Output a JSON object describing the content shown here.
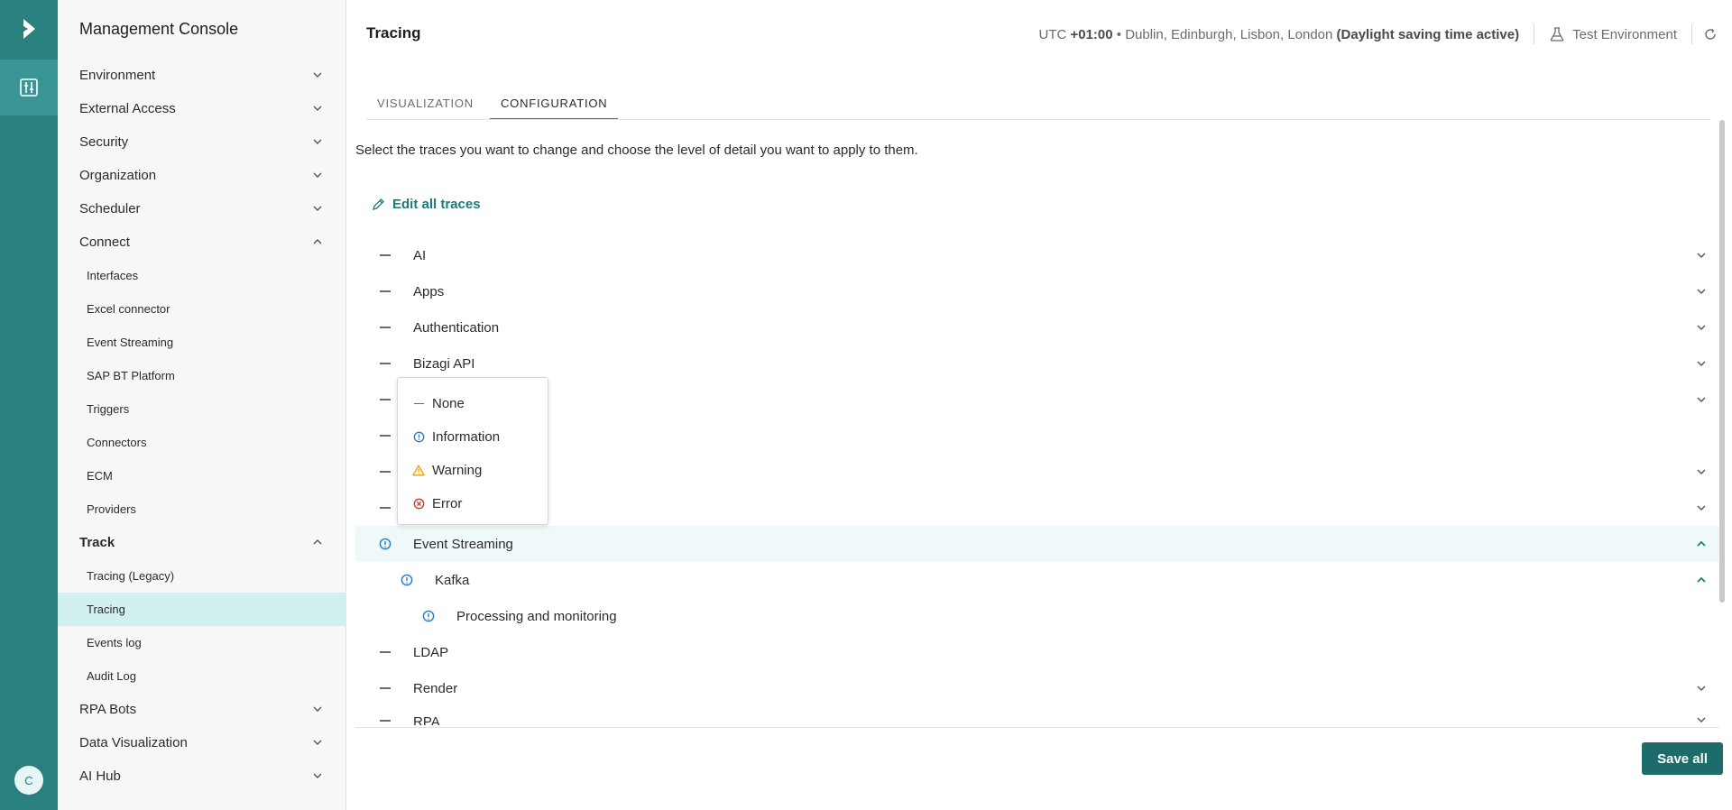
{
  "app": {
    "title": "Management Console",
    "avatar_initial": "C"
  },
  "colors": {
    "accent": "#2a7f7f",
    "info": "#1f7acc",
    "warning": "#e8a000",
    "error": "#d93025"
  },
  "sidebar": {
    "sections": [
      {
        "label": "Environment"
      },
      {
        "label": "External Access"
      },
      {
        "label": "Security"
      },
      {
        "label": "Organization"
      },
      {
        "label": "Scheduler"
      },
      {
        "label": "Connect",
        "children": [
          "Interfaces",
          "Excel connector",
          "Event Streaming",
          "SAP BT Platform",
          "Triggers",
          "Connectors",
          "ECM",
          "Providers"
        ]
      },
      {
        "label": "Track",
        "children": [
          "Tracing (Legacy)",
          "Tracing",
          "Events log",
          "Audit Log"
        ]
      },
      {
        "label": "RPA Bots"
      },
      {
        "label": "Data Visualization"
      },
      {
        "label": "AI Hub"
      }
    ]
  },
  "header": {
    "title": "Tracing",
    "tz_prefix": "UTC ",
    "tz_offset": "+01:00",
    "tz_cities": " • Dublin, Edinburgh, Lisbon, London ",
    "tz_dst": "(Daylight saving time active)",
    "environment": "Test Environment"
  },
  "tabs": [
    {
      "label": "VISUALIZATION"
    },
    {
      "label": "CONFIGURATION"
    }
  ],
  "config": {
    "description": "Select the traces you want to change and choose the level of detail you want to apply to them.",
    "edit_all": "Edit all traces",
    "traces": [
      {
        "name": "AI",
        "level": "none"
      },
      {
        "name": "Apps",
        "level": "none"
      },
      {
        "name": "Authentication",
        "level": "none"
      },
      {
        "name": "Bizagi API",
        "level": "none"
      },
      {
        "name": "",
        "level": "none"
      },
      {
        "name": "",
        "level": "none"
      },
      {
        "name": "",
        "level": "none"
      },
      {
        "name": "",
        "level": "none"
      },
      {
        "name": "Event Streaming",
        "level": "information"
      },
      {
        "name": "Kafka",
        "level": "information"
      },
      {
        "name": "Processing and monitoring",
        "level": "information"
      },
      {
        "name": "LDAP",
        "level": "none"
      },
      {
        "name": "Render",
        "level": "none"
      },
      {
        "name": "RPA",
        "level": "none"
      }
    ],
    "save_all": "Save all"
  },
  "level_menu": {
    "options": [
      {
        "label": "None",
        "icon": "dash-icon"
      },
      {
        "label": "Information",
        "icon": "info-icon"
      },
      {
        "label": "Warning",
        "icon": "warning-icon"
      },
      {
        "label": "Error",
        "icon": "error-icon"
      }
    ]
  }
}
